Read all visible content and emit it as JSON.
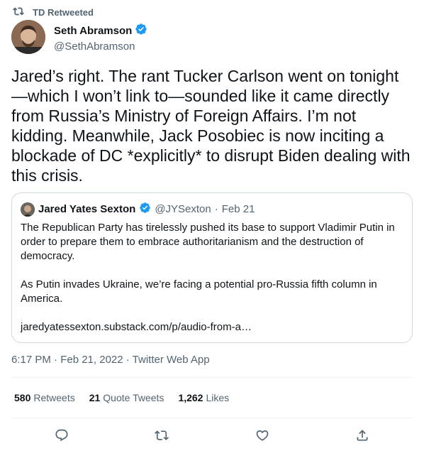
{
  "retweet": {
    "label": "TD Retweeted"
  },
  "author": {
    "name": "Seth Abramson",
    "handle": "@SethAbramson"
  },
  "tweet": {
    "text": "Jared’s right. The rant Tucker Carlson went on tonight —which I won’t link to—sounded like it came directly from Russia’s Ministry of Foreign Affairs. I’m not kidding. Meanwhile, Jack Posobiec is now inciting a blockade of DC *explicitly* to disrupt Biden dealing with this crisis."
  },
  "quote": {
    "name": "Jared Yates Sexton",
    "handle": "@JYSexton",
    "separator": "·",
    "date": "Feb 21",
    "para1": "The Republican Party has tirelessly pushed its base to support Vladimir Putin in order to prepare them to embrace authoritarianism and the destruction of democracy.",
    "para2": "As Putin invades Ukraine, we’re facing a potential pro-Russia fifth column in America.",
    "link": "jaredyatessexton.substack.com/p/audio-from-a…"
  },
  "meta": {
    "text": "6:17 PM · Feb 21, 2022 · Twitter Web App"
  },
  "stats": {
    "retweets_num": "580",
    "retweets_label": "Retweets",
    "quotes_num": "21",
    "quotes_label": "Quote Tweets",
    "likes_num": "1,262",
    "likes_label": "Likes"
  },
  "icons": {
    "retweet": "retweet-icon",
    "verified": "verified-badge-icon",
    "reply": "reply-icon",
    "like": "heart-icon",
    "share": "share-icon"
  },
  "colors": {
    "verified": "#1d9bf0",
    "secondary": "#536471",
    "border": "#cfd9de"
  }
}
